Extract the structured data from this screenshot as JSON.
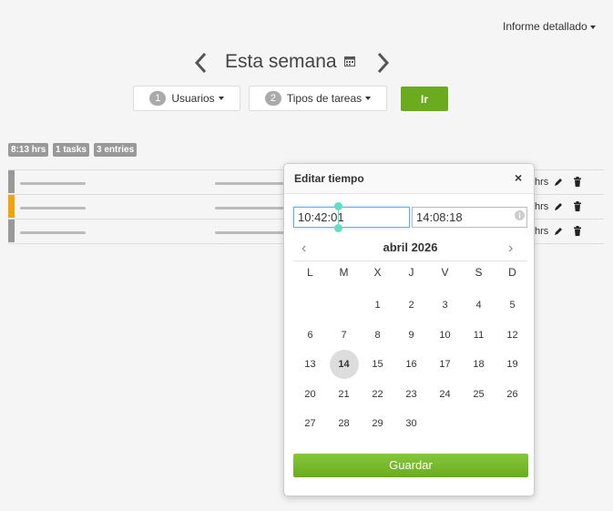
{
  "header": {
    "report_label": "Informe detallado",
    "week_title": "Esta semana"
  },
  "filters": {
    "users_count": "1",
    "users_label": "Usuarios",
    "tasks_count": "2",
    "tasks_label": "Tipos de tareas",
    "go_label": "Ir"
  },
  "summary": {
    "hours": "8:13 hrs",
    "tasks": "1 tasks",
    "entries": "3 entries"
  },
  "entries": [
    {
      "accent": "#999999",
      "hours": "hrs"
    },
    {
      "accent": "#f0a30a",
      "hours": "hrs"
    },
    {
      "accent": "#999999",
      "hours": "hrs"
    }
  ],
  "popover": {
    "title": "Editar tiempo",
    "close": "×",
    "start_time": "10:42:01",
    "end_time": "14:08:18",
    "month_label": "abril 2026",
    "prev": "‹",
    "next": "›",
    "weekdays": [
      "L",
      "M",
      "X",
      "J",
      "V",
      "S",
      "D"
    ],
    "weeks": [
      [
        "",
        "",
        "1",
        "2",
        "3",
        "4",
        "5"
      ],
      [
        "6",
        "7",
        "8",
        "9",
        "10",
        "11",
        "12"
      ],
      [
        "13",
        "14",
        "15",
        "16",
        "17",
        "18",
        "19"
      ],
      [
        "20",
        "21",
        "22",
        "23",
        "24",
        "25",
        "26"
      ],
      [
        "27",
        "28",
        "29",
        "30",
        "",
        "",
        ""
      ]
    ],
    "selected_day": "14",
    "save_label": "Guardar"
  },
  "colors": {
    "accent_green": "#6aab1f",
    "entry_orange": "#f0a30a",
    "focus_blue": "#66afe9"
  }
}
